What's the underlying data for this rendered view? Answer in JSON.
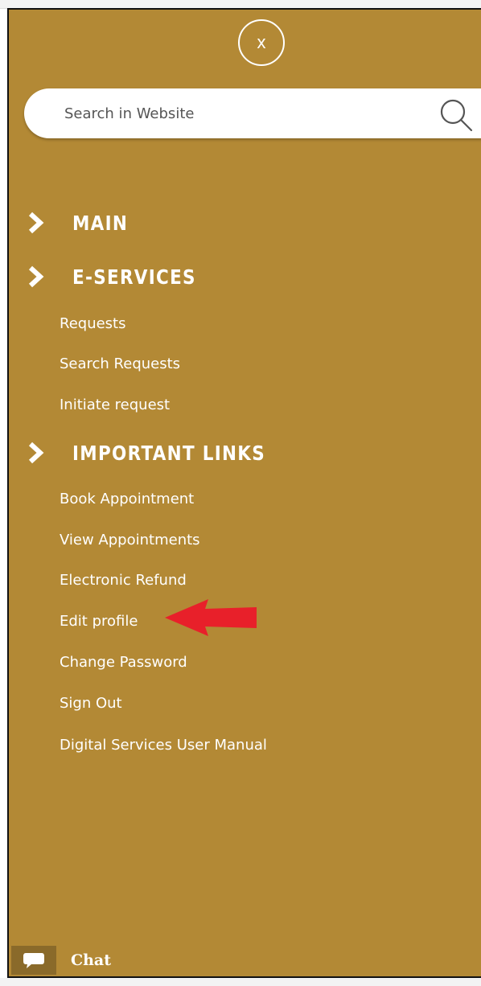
{
  "menu": {
    "close_label": "x",
    "search": {
      "placeholder": "Search in Website",
      "value": ""
    },
    "sections": [
      {
        "label": "MAIN",
        "links": []
      },
      {
        "label": "E-SERVICES",
        "links": [
          "Requests",
          "Search Requests",
          "Initiate request"
        ]
      },
      {
        "label": "IMPORTANT LINKS",
        "links": [
          "Book Appointment",
          "View Appointments",
          "Electronic Refund",
          "Edit profile",
          "Change Password",
          "Sign Out",
          "Digital Services User Manual"
        ]
      }
    ]
  },
  "chat": {
    "label": "Chat"
  },
  "colors": {
    "menu_bg": "#b38935",
    "text": "#ffffff",
    "annotation_arrow": "#e8202a"
  },
  "icons": {
    "search": "search-icon",
    "chevron": "chevron-right-icon",
    "chat": "chat-bubble-icon"
  }
}
